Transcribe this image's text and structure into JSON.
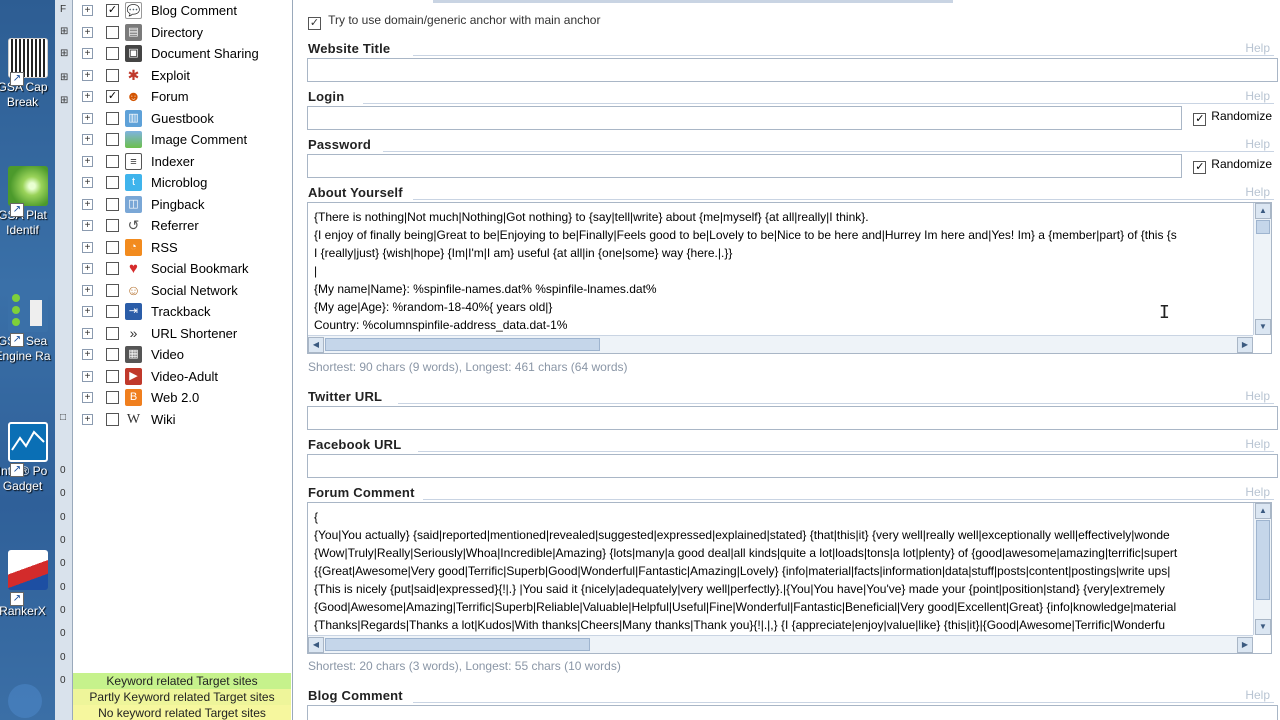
{
  "desktop": {
    "icons": [
      {
        "label1": "GSA Cap",
        "label2": "Break"
      },
      {
        "label1": "GSA Plat",
        "label2": "Identif"
      },
      {
        "label1": "GSA Sea",
        "label2": "Engine Ra"
      },
      {
        "label1": "Intel® Po",
        "label2": "Gadget"
      },
      {
        "label1": "RankerX",
        "label2": ""
      }
    ]
  },
  "tree": {
    "items": [
      {
        "label": "Blog Comment",
        "checked": true
      },
      {
        "label": "Directory",
        "checked": false
      },
      {
        "label": "Document Sharing",
        "checked": false
      },
      {
        "label": "Exploit",
        "checked": false
      },
      {
        "label": "Forum",
        "checked": true
      },
      {
        "label": "Guestbook",
        "checked": false
      },
      {
        "label": "Image Comment",
        "checked": false
      },
      {
        "label": "Indexer",
        "checked": false
      },
      {
        "label": "Microblog",
        "checked": false
      },
      {
        "label": "Pingback",
        "checked": false
      },
      {
        "label": "Referrer",
        "checked": false
      },
      {
        "label": "RSS",
        "checked": false
      },
      {
        "label": "Social Bookmark",
        "checked": false
      },
      {
        "label": "Social Network",
        "checked": false
      },
      {
        "label": "Trackback",
        "checked": false
      },
      {
        "label": "URL Shortener",
        "checked": false
      },
      {
        "label": "Video",
        "checked": false
      },
      {
        "label": "Video-Adult",
        "checked": false
      },
      {
        "label": "Web 2.0",
        "checked": false
      },
      {
        "label": "Wiki",
        "checked": false
      }
    ],
    "legend": {
      "keyword": "Keyword related Target sites",
      "partly": "Partly Keyword related Target sites",
      "none": "No keyword related Target sites"
    },
    "colors": {
      "keyword": "#c6f28c",
      "partly": "#eef59a",
      "none": "#f6f79e"
    }
  },
  "form": {
    "top_option": "Try to use domain/generic anchor with main anchor",
    "help": "Help",
    "randomize": "Randomize",
    "website_title": {
      "label": "Website Title",
      "value": ""
    },
    "login": {
      "label": "Login",
      "value": ""
    },
    "password": {
      "label": "Password",
      "value": ""
    },
    "about": {
      "label": "About Yourself",
      "lines": [
        "{There is nothing|Not much|Nothing|Got nothing} to {say|tell|write} about {me|myself} {at all|really|I think}.",
        "{I enjoy of finally being|Great to be|Enjoying to be|Finally|Feels good to be|Lovely to be|Nice to be here and|Hurrey Im here and|Yes! Im} a {member|part} of {this {s",
        "I {really|just} {wish|hope} {Im|I'm|I am} useful {at all|in {one|some} way {here.|.}}",
        "|",
        "{My name|Name}: %spinfile-names.dat% %spinfile-lnames.dat%",
        "{My age|Age}: %random-18-40%{ years old|}",
        "Country: %columnspinfile-address_data.dat-1%"
      ],
      "stats": "Shortest: 90 chars (9 words), Longest: 461 chars (64 words)"
    },
    "twitter": {
      "label": "Twitter URL",
      "value": ""
    },
    "facebook": {
      "label": "Facebook URL",
      "value": ""
    },
    "forum_comment": {
      "label": "Forum Comment",
      "lines": [
        "{",
        "{You|You actually} {said|reported|mentioned|revealed|suggested|expressed|explained|stated} {that|this|it} {very well|really well|exceptionally well|effectively|wonde",
        "{Wow|Truly|Really|Seriously|Whoa|Incredible|Amazing} {lots|many|a good deal|all kinds|quite a lot|loads|tons|a lot|plenty} of {good|awesome|amazing|terrific|supert",
        "{{Great|Awesome|Very good|Terrific|Superb|Good|Wonderful|Fantastic|Amazing|Lovely} {info|material|facts|information|data|stuff|posts|content|postings|write ups|",
        "{This is nicely {put|said|expressed}{!|.} |You said it {nicely|adequately|very well|perfectly}.|{You|You have|You've} made your {point|position|stand} {very|extremely",
        "{Good|Awesome|Amazing|Terrific|Superb|Reliable|Valuable|Helpful|Useful|Fine|Wonderful|Fantastic|Beneficial|Very good|Excellent|Great} {info|knowledge|material",
        "{Thanks|Regards|Thanks a lot|Kudos|With thanks|Cheers|Many thanks|Thank you}{!|.|,} {I {appreciate|enjoy|value|like} {this|it}|{Good|Awesome|Terrific|Wonderfu"
      ],
      "stats": "Shortest: 20 chars (3 words), Longest: 55 chars (10 words)"
    },
    "blog_comment": {
      "label": "Blog Comment"
    }
  }
}
